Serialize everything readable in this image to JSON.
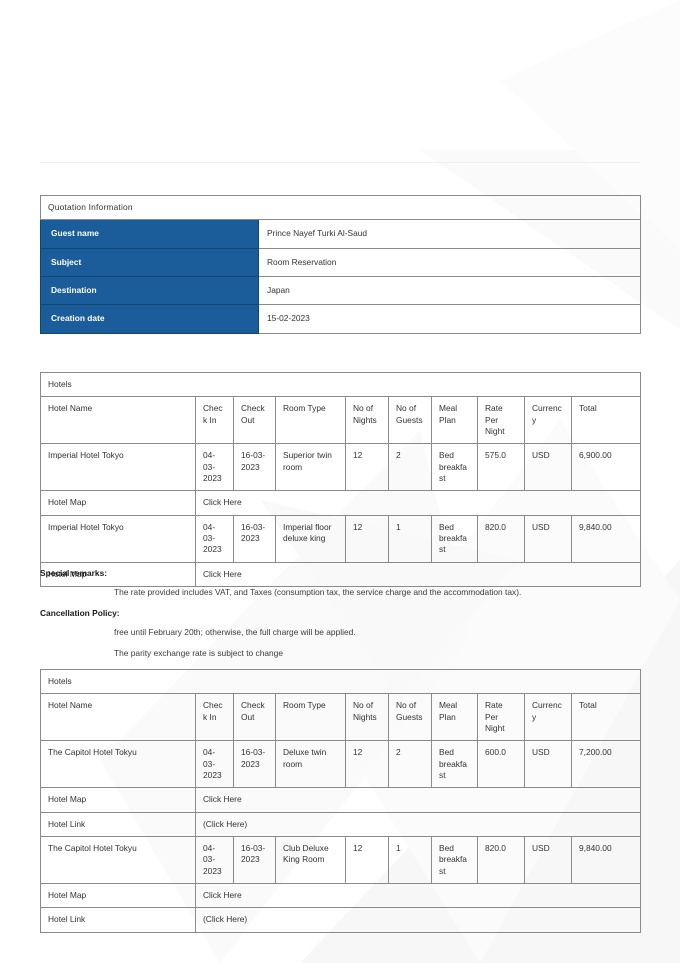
{
  "document": {
    "page_background": "#ffffff",
    "accent_color": "#1B5C9B",
    "accent_border_color": "#12456f",
    "text_color": "#333333"
  },
  "quotation": {
    "title": "Quotation Information",
    "rows": [
      {
        "label": "Guest name",
        "value": "Prince Nayef Turki Al-Saud"
      },
      {
        "label": "Subject",
        "value": "Room Reservation"
      },
      {
        "label": "Destination",
        "value": "Japan"
      },
      {
        "label": "Creation date",
        "value": "15-02-2023"
      }
    ]
  },
  "hotels_columns": [
    "Hotel Name",
    "Check In",
    "Check Out",
    "Room Type",
    "No of Nights",
    "No of Guests",
    "Meal Plan",
    "Rate Per Night",
    "Currency",
    "Total"
  ],
  "hotels_table_1": {
    "title": "Hotels",
    "rows": [
      {
        "hotel_name": "Imperial Hotel Tokyo",
        "check_in": "04-03-2023",
        "check_out": "16-03-2023",
        "room_type": "Superior twin room",
        "nights": "12",
        "guests": "2",
        "meal_plan": "Bed breakfast",
        "rate_per_night": "575.0",
        "currency": "USD",
        "total": "6,900.00"
      },
      {
        "hotel_name": "Imperial Hotel Tokyo",
        "check_in": "04-03-2023",
        "check_out": "16-03-2023",
        "room_type": "Imperial floor deluxe king",
        "nights": "12",
        "guests": "1",
        "meal_plan": "Bed breakfast",
        "rate_per_night": "820.0",
        "currency": "USD",
        "total": "9,840.00"
      }
    ],
    "extra_rows": [
      {
        "label": "Hotel Map",
        "value": "Click Here",
        "after_row": 0
      },
      {
        "label": "Hotel Map",
        "value": "Click Here",
        "after_row": 1
      }
    ]
  },
  "remarks": {
    "special_remarks_title": "Special remarks:",
    "special_remarks_body": "The rate provided includes VAT, and Taxes (consumption tax, the service charge and the accommodation tax).",
    "cancellation_title": "Cancellation Policy:",
    "cancellation_line_1": "free until February 20th; otherwise, the full charge will be applied.",
    "cancellation_line_2": "The parity exchange rate is subject to change"
  },
  "hotels_table_2": {
    "title": "Hotels",
    "rows": [
      {
        "hotel_name": "The Capitol Hotel Tokyu",
        "check_in": "04-03-2023",
        "check_out": "16-03-2023",
        "room_type": "Deluxe twin room",
        "nights": "12",
        "guests": "2",
        "meal_plan": "Bed breakfast",
        "rate_per_night": "600.0",
        "currency": "USD",
        "total": "7,200.00"
      },
      {
        "hotel_name": "The Capitol Hotel Tokyu",
        "check_in": "04-03-2023",
        "check_out": "16-03-2023",
        "room_type": "Club Deluxe King Room",
        "nights": "12",
        "guests": "1",
        "meal_plan": "Bed breakfast",
        "rate_per_night": "820.0",
        "currency": "USD",
        "total": "9,840.00"
      }
    ],
    "map_label": "Hotel Map",
    "map_value": "Click Here",
    "link_label": "Hotel Link",
    "link_value": "(Click Here)"
  }
}
